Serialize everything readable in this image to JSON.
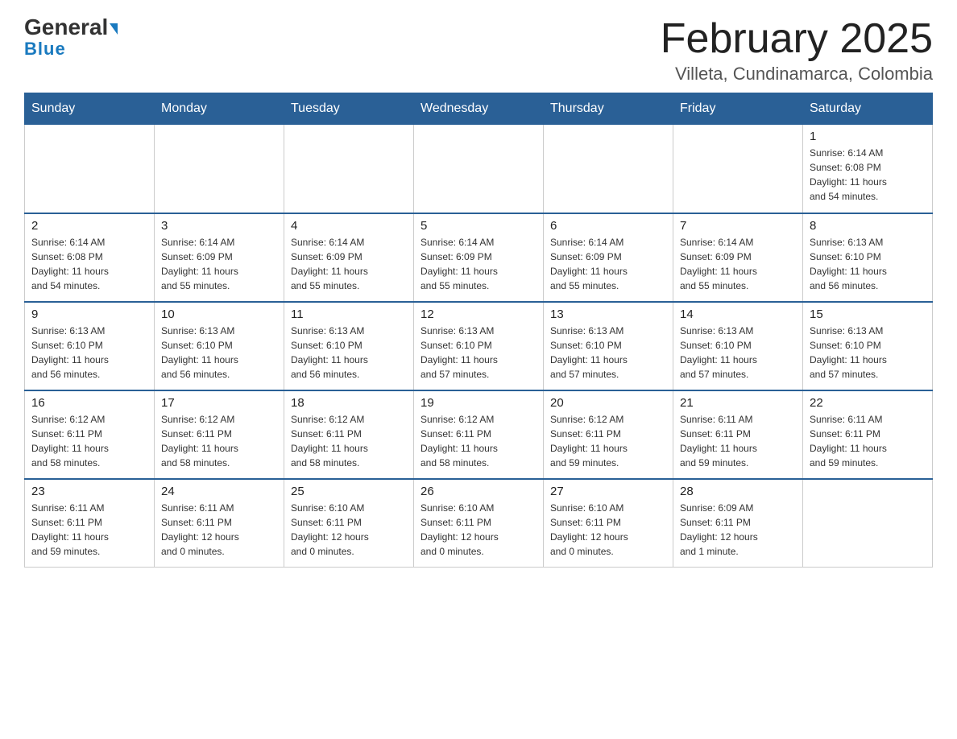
{
  "header": {
    "logo_general": "General",
    "logo_blue": "Blue",
    "month_title": "February 2025",
    "location": "Villeta, Cundinamarca, Colombia"
  },
  "weekdays": [
    "Sunday",
    "Monday",
    "Tuesday",
    "Wednesday",
    "Thursday",
    "Friday",
    "Saturday"
  ],
  "weeks": [
    [
      {
        "day": "",
        "info": ""
      },
      {
        "day": "",
        "info": ""
      },
      {
        "day": "",
        "info": ""
      },
      {
        "day": "",
        "info": ""
      },
      {
        "day": "",
        "info": ""
      },
      {
        "day": "",
        "info": ""
      },
      {
        "day": "1",
        "info": "Sunrise: 6:14 AM\nSunset: 6:08 PM\nDaylight: 11 hours\nand 54 minutes."
      }
    ],
    [
      {
        "day": "2",
        "info": "Sunrise: 6:14 AM\nSunset: 6:08 PM\nDaylight: 11 hours\nand 54 minutes."
      },
      {
        "day": "3",
        "info": "Sunrise: 6:14 AM\nSunset: 6:09 PM\nDaylight: 11 hours\nand 55 minutes."
      },
      {
        "day": "4",
        "info": "Sunrise: 6:14 AM\nSunset: 6:09 PM\nDaylight: 11 hours\nand 55 minutes."
      },
      {
        "day": "5",
        "info": "Sunrise: 6:14 AM\nSunset: 6:09 PM\nDaylight: 11 hours\nand 55 minutes."
      },
      {
        "day": "6",
        "info": "Sunrise: 6:14 AM\nSunset: 6:09 PM\nDaylight: 11 hours\nand 55 minutes."
      },
      {
        "day": "7",
        "info": "Sunrise: 6:14 AM\nSunset: 6:09 PM\nDaylight: 11 hours\nand 55 minutes."
      },
      {
        "day": "8",
        "info": "Sunrise: 6:13 AM\nSunset: 6:10 PM\nDaylight: 11 hours\nand 56 minutes."
      }
    ],
    [
      {
        "day": "9",
        "info": "Sunrise: 6:13 AM\nSunset: 6:10 PM\nDaylight: 11 hours\nand 56 minutes."
      },
      {
        "day": "10",
        "info": "Sunrise: 6:13 AM\nSunset: 6:10 PM\nDaylight: 11 hours\nand 56 minutes."
      },
      {
        "day": "11",
        "info": "Sunrise: 6:13 AM\nSunset: 6:10 PM\nDaylight: 11 hours\nand 56 minutes."
      },
      {
        "day": "12",
        "info": "Sunrise: 6:13 AM\nSunset: 6:10 PM\nDaylight: 11 hours\nand 57 minutes."
      },
      {
        "day": "13",
        "info": "Sunrise: 6:13 AM\nSunset: 6:10 PM\nDaylight: 11 hours\nand 57 minutes."
      },
      {
        "day": "14",
        "info": "Sunrise: 6:13 AM\nSunset: 6:10 PM\nDaylight: 11 hours\nand 57 minutes."
      },
      {
        "day": "15",
        "info": "Sunrise: 6:13 AM\nSunset: 6:10 PM\nDaylight: 11 hours\nand 57 minutes."
      }
    ],
    [
      {
        "day": "16",
        "info": "Sunrise: 6:12 AM\nSunset: 6:11 PM\nDaylight: 11 hours\nand 58 minutes."
      },
      {
        "day": "17",
        "info": "Sunrise: 6:12 AM\nSunset: 6:11 PM\nDaylight: 11 hours\nand 58 minutes."
      },
      {
        "day": "18",
        "info": "Sunrise: 6:12 AM\nSunset: 6:11 PM\nDaylight: 11 hours\nand 58 minutes."
      },
      {
        "day": "19",
        "info": "Sunrise: 6:12 AM\nSunset: 6:11 PM\nDaylight: 11 hours\nand 58 minutes."
      },
      {
        "day": "20",
        "info": "Sunrise: 6:12 AM\nSunset: 6:11 PM\nDaylight: 11 hours\nand 59 minutes."
      },
      {
        "day": "21",
        "info": "Sunrise: 6:11 AM\nSunset: 6:11 PM\nDaylight: 11 hours\nand 59 minutes."
      },
      {
        "day": "22",
        "info": "Sunrise: 6:11 AM\nSunset: 6:11 PM\nDaylight: 11 hours\nand 59 minutes."
      }
    ],
    [
      {
        "day": "23",
        "info": "Sunrise: 6:11 AM\nSunset: 6:11 PM\nDaylight: 11 hours\nand 59 minutes."
      },
      {
        "day": "24",
        "info": "Sunrise: 6:11 AM\nSunset: 6:11 PM\nDaylight: 12 hours\nand 0 minutes."
      },
      {
        "day": "25",
        "info": "Sunrise: 6:10 AM\nSunset: 6:11 PM\nDaylight: 12 hours\nand 0 minutes."
      },
      {
        "day": "26",
        "info": "Sunrise: 6:10 AM\nSunset: 6:11 PM\nDaylight: 12 hours\nand 0 minutes."
      },
      {
        "day": "27",
        "info": "Sunrise: 6:10 AM\nSunset: 6:11 PM\nDaylight: 12 hours\nand 0 minutes."
      },
      {
        "day": "28",
        "info": "Sunrise: 6:09 AM\nSunset: 6:11 PM\nDaylight: 12 hours\nand 1 minute."
      },
      {
        "day": "",
        "info": ""
      }
    ]
  ]
}
